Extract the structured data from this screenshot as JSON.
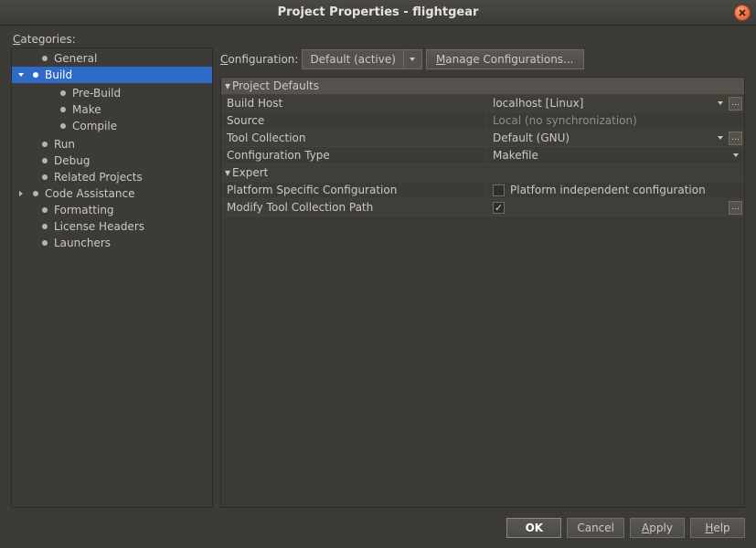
{
  "title": "Project Properties - flightgear",
  "categories_label": "Categories:",
  "tree": {
    "items": [
      {
        "label": "General"
      },
      {
        "label": "Build",
        "selected": true,
        "children": [
          {
            "label": "Pre-Build"
          },
          {
            "label": "Make"
          },
          {
            "label": "Compile"
          }
        ]
      },
      {
        "label": "Run"
      },
      {
        "label": "Debug"
      },
      {
        "label": "Related Projects"
      },
      {
        "label": "Code Assistance",
        "has_children": true
      },
      {
        "label": "Formatting"
      },
      {
        "label": "License Headers"
      },
      {
        "label": "Launchers"
      }
    ]
  },
  "config_bar": {
    "label": "Configuration:",
    "selected": "Default (active)",
    "manage": "Manage Configurations..."
  },
  "sheet": {
    "section1": "Project Defaults",
    "rows1": [
      {
        "label": "Build Host",
        "value": "localhost [Linux]",
        "dropdown": true,
        "ellipsis": true
      },
      {
        "label": "Source",
        "value": "Local (no synchronization)",
        "dim": true
      },
      {
        "label": "Tool Collection",
        "value": "Default (GNU)",
        "dropdown": true,
        "ellipsis": true
      },
      {
        "label": "Configuration Type",
        "value": "Makefile",
        "dropdown": true
      }
    ],
    "section2": "Expert",
    "rows2": [
      {
        "label": "Platform Specific Configuration",
        "check": false,
        "text": "Platform independent configuration"
      },
      {
        "label": "Modify Tool Collection Path",
        "check": true,
        "ellipsis": true
      }
    ]
  },
  "footer": {
    "ok": "OK",
    "cancel": "Cancel",
    "apply": "Apply",
    "help": "Help"
  }
}
